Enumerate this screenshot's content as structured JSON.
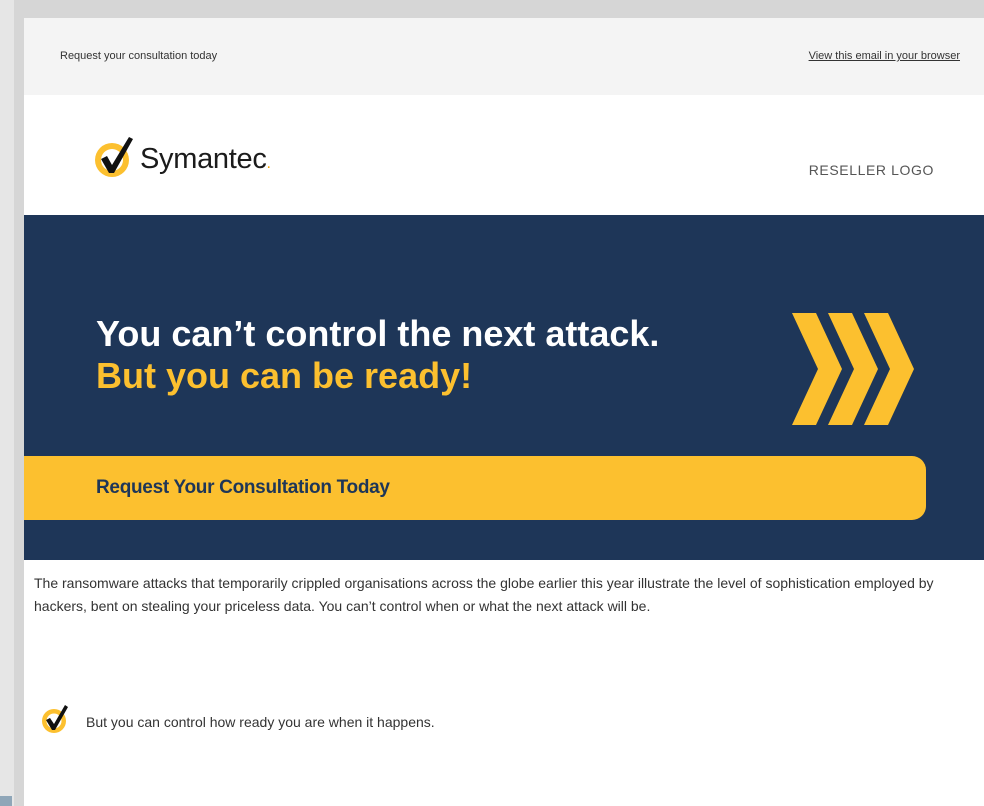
{
  "preheader": {
    "text": "Request your consultation today",
    "browser_link": "View this email in your browser"
  },
  "header": {
    "brand": "Symantec",
    "brand_suffix": ".",
    "reseller_logo": "RESELLER LOGO"
  },
  "hero": {
    "headline": "You can’t control the next attack.",
    "subheadline": "But you can be ready!",
    "cta_label": "Request Your Consultation Today"
  },
  "body": {
    "paragraph": "The ransomware attacks that temporarily crippled organisations across the globe earlier this year illustrate the level of sophistication employed by hackers, bent on stealing your priceless data. You can’t control when or what the next attack will be.",
    "bullet_text": "But you can control how ready you are when it happens."
  },
  "icons": {
    "brand_logo": "checkmark-circle-icon",
    "hero_decoration": "triple-chevron-icon",
    "bullet": "checkmark-circle-icon"
  },
  "colors": {
    "navy": "#1e3658",
    "yellow": "#fcc02f",
    "text": "#333333"
  }
}
